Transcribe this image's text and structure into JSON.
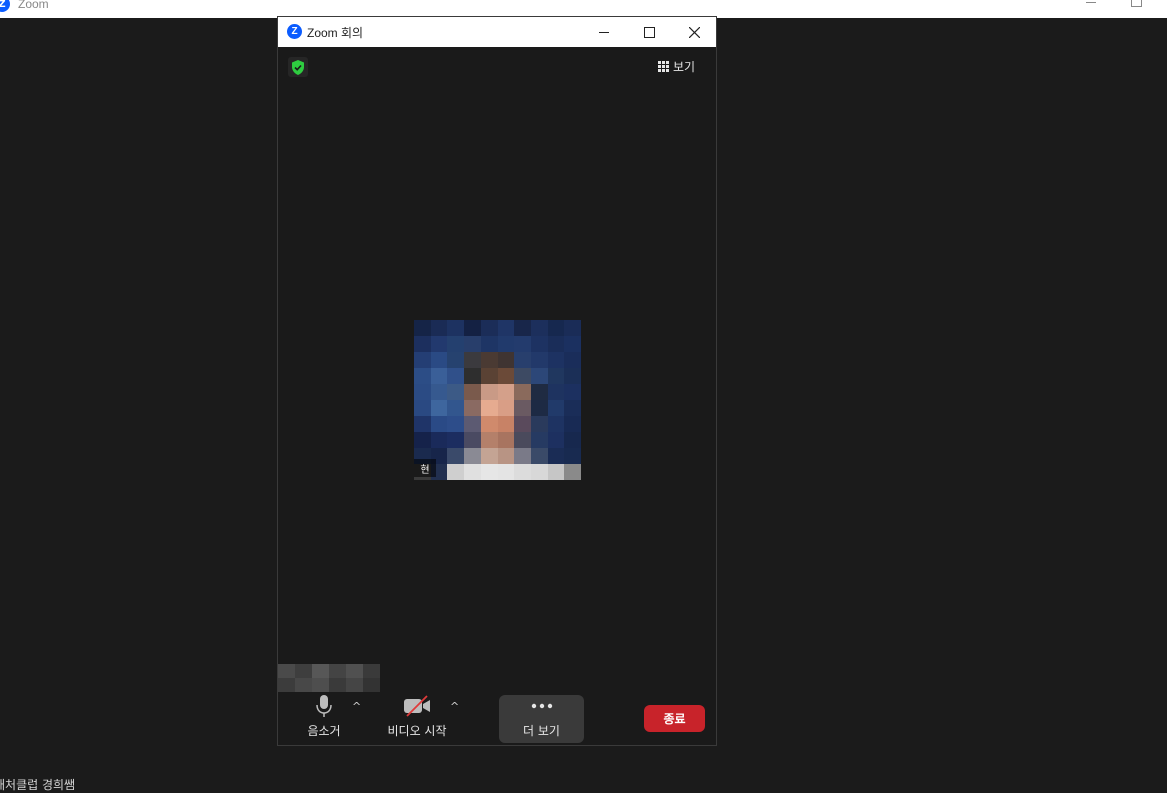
{
  "background_window": {
    "title": "Zoom"
  },
  "meeting_window": {
    "title": "Zoom 회의",
    "view_label": "보기"
  },
  "participant": {
    "name_fragment": "현"
  },
  "toolbar": {
    "mute_label": "음소거",
    "video_label": "비디오 시작",
    "more_label": "더 보기",
    "end_label": "종료"
  },
  "bottom_text": "채처클럽 경희쌤",
  "colors": {
    "zoom_blue": "#0b5cff",
    "end_red": "#c8232a",
    "shield_green": "#2ecc40",
    "video_off_red": "#e03a3a"
  }
}
